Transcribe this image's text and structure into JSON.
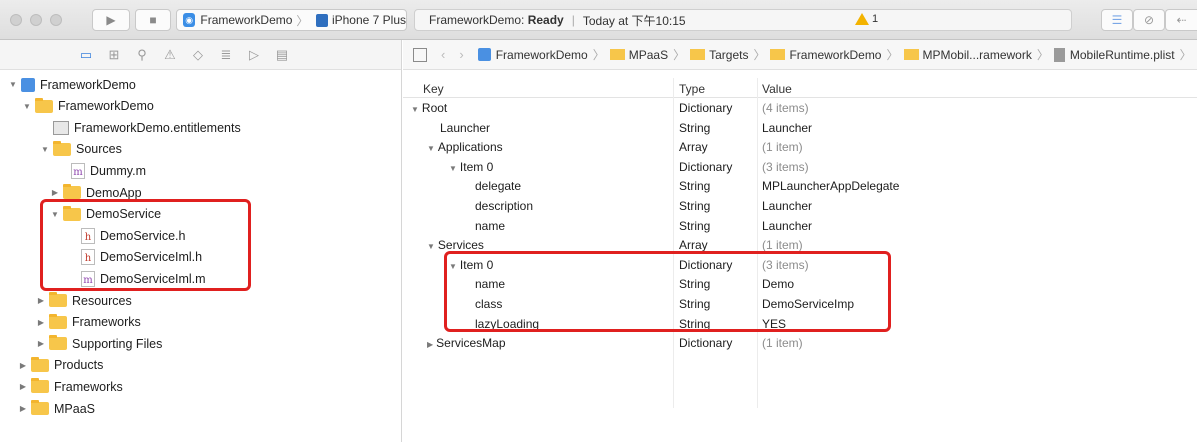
{
  "toolbar": {
    "scheme_project": "FrameworkDemo",
    "scheme_device": "iPhone 7 Plus",
    "status_prefix": "FrameworkDemo:",
    "status_state": "Ready",
    "status_time": "Today at 下午10:15",
    "warning_count": "1"
  },
  "jumpbar": {
    "items": [
      "FrameworkDemo",
      "MPaaS",
      "Targets",
      "FrameworkDemo",
      "MPMobil...ramework",
      "MobileRuntime.plist"
    ]
  },
  "navigator": {
    "rows": [
      {
        "label": "FrameworkDemo",
        "disclosure": "▼",
        "icon": "project-icon"
      },
      {
        "label": "FrameworkDemo",
        "disclosure": "▼",
        "icon": "folder-icon"
      },
      {
        "label": "FrameworkDemo.entitlements",
        "disclosure": "",
        "icon": "entitlements-icon"
      },
      {
        "label": "Sources",
        "disclosure": "▼",
        "icon": "folder-icon"
      },
      {
        "label": "Dummy.m",
        "disclosure": "",
        "icon": "m-file-icon"
      },
      {
        "label": "DemoApp",
        "disclosure": "▶",
        "icon": "folder-icon"
      },
      {
        "label": "DemoService",
        "disclosure": "▼",
        "icon": "folder-icon"
      },
      {
        "label": "DemoService.h",
        "disclosure": "",
        "icon": "h-file-icon"
      },
      {
        "label": "DemoServiceIml.h",
        "disclosure": "",
        "icon": "h-file-icon"
      },
      {
        "label": "DemoServiceIml.m",
        "disclosure": "",
        "icon": "m-file-icon"
      },
      {
        "label": "Resources",
        "disclosure": "▶",
        "icon": "folder-icon"
      },
      {
        "label": "Frameworks",
        "disclosure": "▶",
        "icon": "folder-icon"
      },
      {
        "label": "Supporting Files",
        "disclosure": "▶",
        "icon": "folder-icon"
      },
      {
        "label": "Products",
        "disclosure": "▶",
        "icon": "folder-icon"
      },
      {
        "label": "Frameworks",
        "disclosure": "▶",
        "icon": "folder-icon"
      },
      {
        "label": "MPaaS",
        "disclosure": "▶",
        "icon": "folder-icon"
      }
    ]
  },
  "plist": {
    "headers": {
      "key": "Key",
      "type": "Type",
      "value": "Value"
    },
    "rows": [
      {
        "key": "Root",
        "disclosure": "▼",
        "type": "Dictionary",
        "value": "(4 items)",
        "muted": true
      },
      {
        "key": "Launcher",
        "disclosure": "",
        "type": "String",
        "value": "Launcher",
        "muted": false
      },
      {
        "key": "Applications",
        "disclosure": "▼",
        "type": "Array",
        "value": "(1 item)",
        "muted": true
      },
      {
        "key": "Item 0",
        "disclosure": "▼",
        "type": "Dictionary",
        "value": "(3 items)",
        "muted": true
      },
      {
        "key": "delegate",
        "disclosure": "",
        "type": "String",
        "value": "MPLauncherAppDelegate",
        "muted": false
      },
      {
        "key": "description",
        "disclosure": "",
        "type": "String",
        "value": "Launcher",
        "muted": false
      },
      {
        "key": "name",
        "disclosure": "",
        "type": "String",
        "value": "Launcher",
        "muted": false
      },
      {
        "key": "Services",
        "disclosure": "▼",
        "type": "Array",
        "value": "(1 item)",
        "muted": true
      },
      {
        "key": "Item 0",
        "disclosure": "▼",
        "type": "Dictionary",
        "value": "(3 items)",
        "muted": true
      },
      {
        "key": "name",
        "disclosure": "",
        "type": "String",
        "value": "Demo",
        "muted": false
      },
      {
        "key": "class",
        "disclosure": "",
        "type": "String",
        "value": "DemoServiceImp",
        "muted": false
      },
      {
        "key": "lazyLoading",
        "disclosure": "",
        "type": "String",
        "value": "YES",
        "muted": false
      },
      {
        "key": "ServicesMap",
        "disclosure": "▶",
        "type": "Dictionary",
        "value": "(1 item)",
        "muted": true
      }
    ]
  },
  "colors": {
    "highlight": "#e0201f",
    "folder": "#f7c64a",
    "accent": "#3b82dd"
  }
}
